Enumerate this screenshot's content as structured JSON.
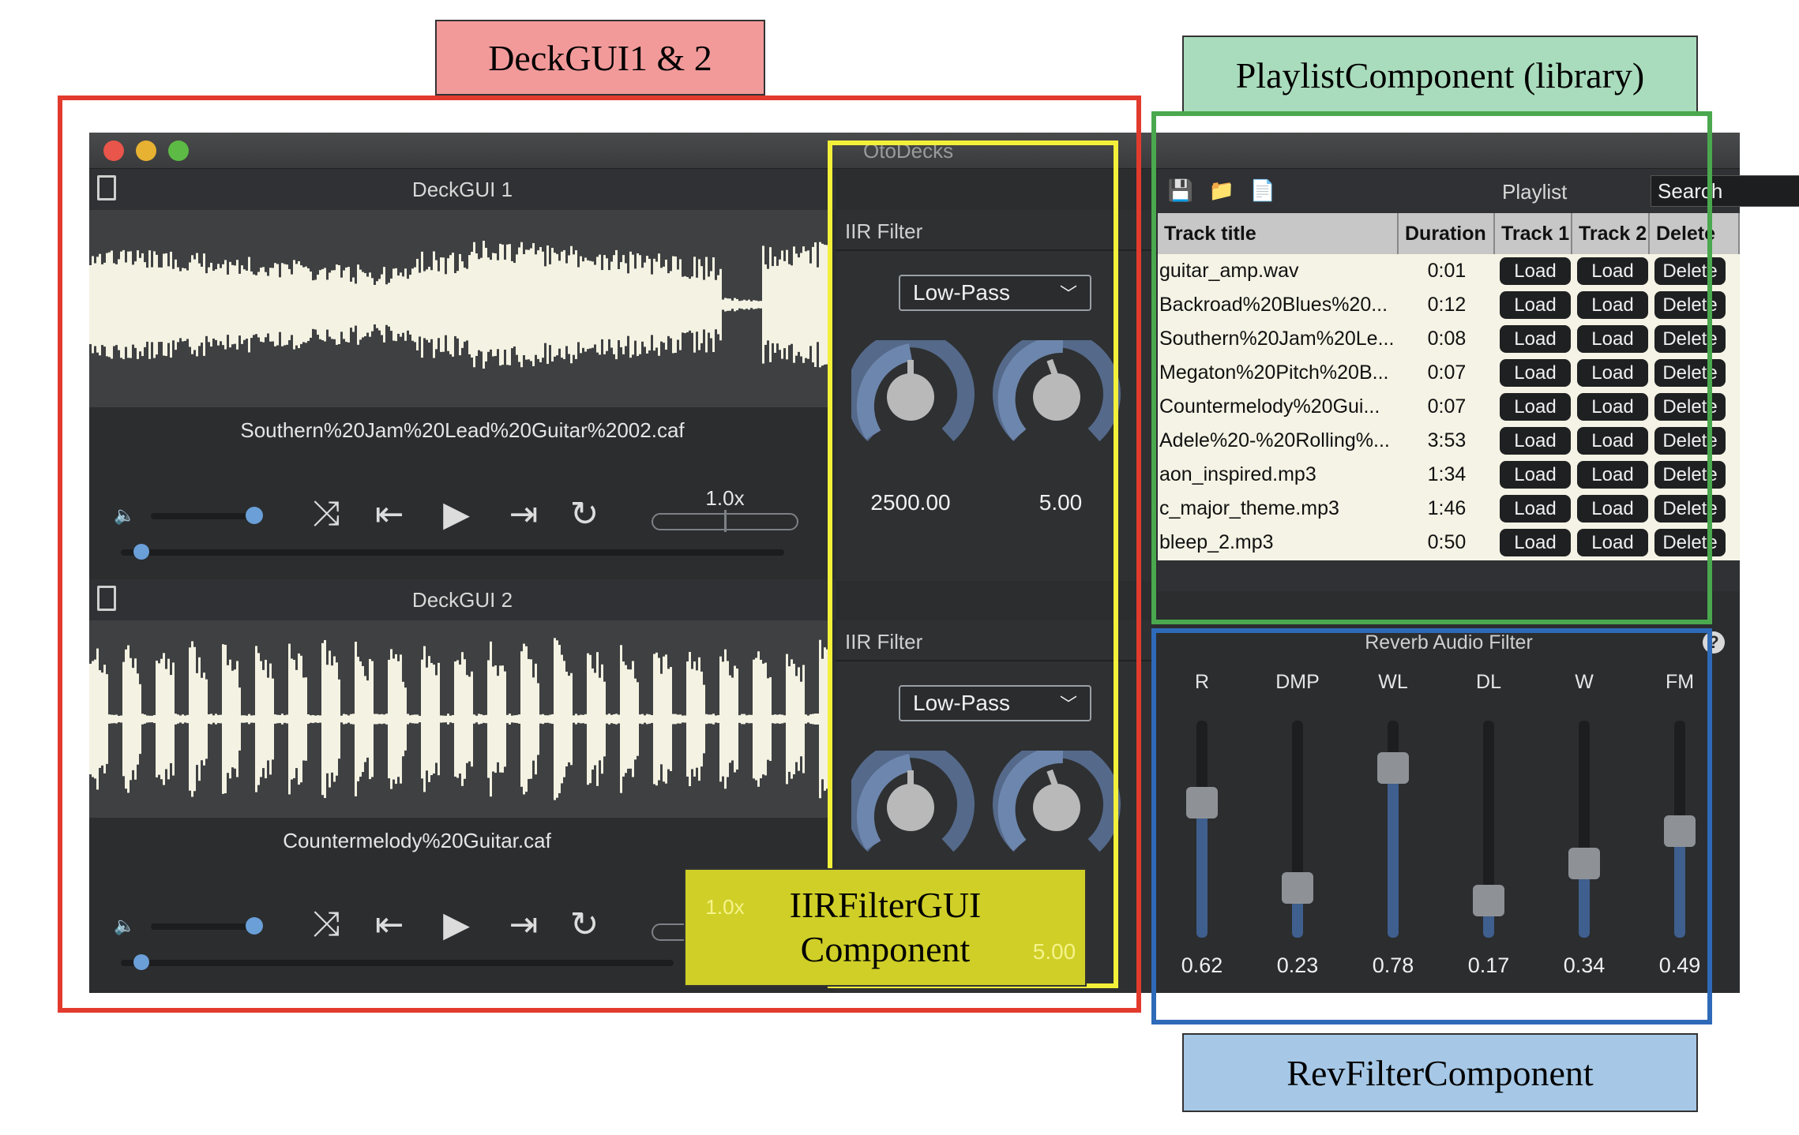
{
  "captions": {
    "deck": "DeckGUI1 & 2",
    "playlist": "PlaylistComponent (library)",
    "iir": "IIRFilterGUI\nComponent",
    "rev": "RevFilterComponent"
  },
  "colors": {
    "deck_caption_bg": "#f29a9a",
    "deck_frame": "#e23b2e",
    "playlist_caption_bg": "#a9dcbc",
    "playlist_frame": "#4aa84e",
    "iir_frame": "#f3f03a",
    "iir_caption_bg": "#cfcf28",
    "rev_caption_bg": "#a6c8e6",
    "rev_frame": "#2f6ab8"
  },
  "app": {
    "title": "OtoDecks",
    "decks": [
      {
        "header": "DeckGUI 1",
        "filename": "Southern%20Jam%20Lead%20Guitar%2002.caf",
        "speed": "1.0x",
        "volume": 0.73,
        "position": 0.0,
        "filter": {
          "title": "IIR Filter",
          "type": "Low-Pass",
          "freq": "2500.00",
          "q": "5.00"
        }
      },
      {
        "header": "DeckGUI 2",
        "filename": "Countermelody%20Guitar.caf",
        "speed": "1.0x",
        "volume": 0.73,
        "position": 0.0,
        "filter": {
          "title": "IIR Filter",
          "type": "Low-Pass",
          "freq": "",
          "q": "5.00"
        }
      }
    ],
    "playlist": {
      "title": "Playlist",
      "search_placeholder": "Search",
      "columns": [
        "Track title",
        "Duration",
        "Track 1",
        "Track 2",
        "Delete"
      ],
      "load_label": "Load",
      "delete_label": "Delete",
      "rows": [
        {
          "title": "guitar_amp.wav",
          "duration": "0:01"
        },
        {
          "title": "Backroad%20Blues%20...",
          "duration": "0:12"
        },
        {
          "title": "Southern%20Jam%20Le...",
          "duration": "0:08"
        },
        {
          "title": "Megaton%20Pitch%20B...",
          "duration": "0:07"
        },
        {
          "title": "Countermelody%20Gui...",
          "duration": "0:07"
        },
        {
          "title": "Adele%20-%20Rolling%...",
          "duration": "3:53"
        },
        {
          "title": "aon_inspired.mp3",
          "duration": "1:34"
        },
        {
          "title": "c_major_theme.mp3",
          "duration": "1:46"
        },
        {
          "title": "bleep_2.mp3",
          "duration": "0:50"
        }
      ]
    },
    "reverb": {
      "title": "Reverb Audio Filter",
      "sliders": [
        {
          "label": "R",
          "value": "0.62",
          "level": 0.62
        },
        {
          "label": "DMP",
          "value": "0.23",
          "level": 0.23
        },
        {
          "label": "WL",
          "value": "0.78",
          "level": 0.78
        },
        {
          "label": "DL",
          "value": "0.17",
          "level": 0.17
        },
        {
          "label": "W",
          "value": "0.34",
          "level": 0.34
        },
        {
          "label": "FM",
          "value": "0.49",
          "level": 0.49
        }
      ]
    }
  }
}
